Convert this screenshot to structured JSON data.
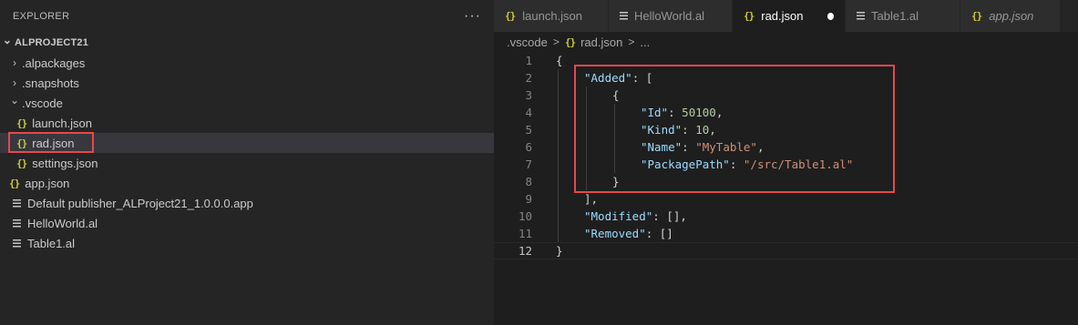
{
  "sidebar": {
    "title": "EXPLORER",
    "more_label": "···",
    "project": "ALPROJECT21",
    "items": [
      {
        "label": ".alpackages",
        "kind": "folder",
        "expanded": false
      },
      {
        "label": ".snapshots",
        "kind": "folder",
        "expanded": false
      },
      {
        "label": ".vscode",
        "kind": "folder",
        "expanded": true
      },
      {
        "label": "launch.json",
        "kind": "json"
      },
      {
        "label": "rad.json",
        "kind": "json",
        "selected": true
      },
      {
        "label": "settings.json",
        "kind": "json"
      },
      {
        "label": "app.json",
        "kind": "json"
      },
      {
        "label": "Default publisher_ALProject21_1.0.0.0.app",
        "kind": "al"
      },
      {
        "label": "HelloWorld.al",
        "kind": "al"
      },
      {
        "label": "Table1.al",
        "kind": "al"
      }
    ]
  },
  "icons": {
    "json_glyph": "{}",
    "chevron_right": "›",
    "chevron_down": "⌄"
  },
  "tabs": [
    {
      "label": "launch.json",
      "icon": "json"
    },
    {
      "label": "HelloWorld.al",
      "icon": "al"
    },
    {
      "label": "rad.json",
      "icon": "json",
      "active": true,
      "modified": true
    },
    {
      "label": "Table1.al",
      "icon": "al"
    },
    {
      "label": "app.json",
      "icon": "json",
      "italic": true
    }
  ],
  "breadcrumb": {
    "folder": ".vscode",
    "sep": ">",
    "file": "rad.json",
    "tail": "..."
  },
  "code": {
    "line_numbers": [
      "1",
      "2",
      "3",
      "4",
      "5",
      "6",
      "7",
      "8",
      "9",
      "10",
      "11",
      "12"
    ],
    "l1": "{",
    "l2_key": "\"Added\"",
    "l2_rest": ": [",
    "l3": "{",
    "l4_key": "\"Id\"",
    "l4_sep": ": ",
    "l4_val": "50100",
    "l4_end": ",",
    "l5_key": "\"Kind\"",
    "l5_sep": ": ",
    "l5_val": "10",
    "l5_end": ",",
    "l6_key": "\"Name\"",
    "l6_sep": ": ",
    "l6_val": "\"MyTable\"",
    "l6_end": ",",
    "l7_key": "\"PackagePath\"",
    "l7_sep": ": ",
    "l7_val": "\"/src/Table1.al\"",
    "l8": "}",
    "l9": "],",
    "l10_key": "\"Modified\"",
    "l10_rest": ": [],",
    "l11_key": "\"Removed\"",
    "l11_rest": ": []",
    "l12": "}"
  },
  "colors": {
    "highlight_border": "#e5484d",
    "json_icon": "#cbcb41",
    "accent_bg": "#1e1e1e"
  }
}
